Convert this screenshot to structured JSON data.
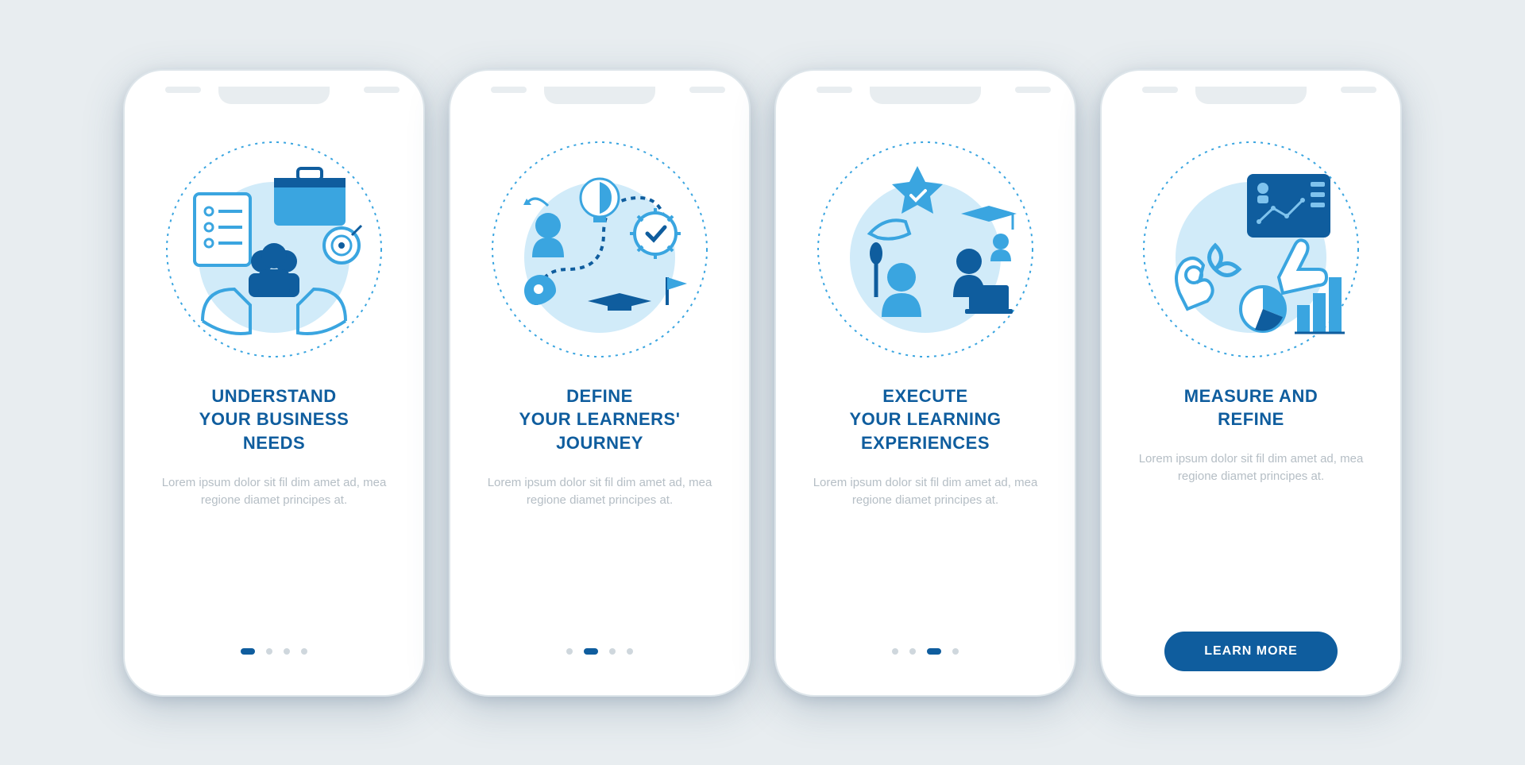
{
  "colors": {
    "primary": "#0f5d9e",
    "accent": "#3aa5e0",
    "light": "#d1ebf9",
    "muted": "#b5bec5"
  },
  "screens": [
    {
      "icon_name": "business-needs-icon",
      "title": "UNDERSTAND\nYOUR BUSINESS\nNEEDS",
      "body": "Lorem ipsum dolor sit fil dim amet ad, mea regione diamet principes at.",
      "active_dot": 0,
      "has_cta": false
    },
    {
      "icon_name": "learners-journey-icon",
      "title": "DEFINE\nYOUR LEARNERS'\nJOURNEY",
      "body": "Lorem ipsum dolor sit fil dim amet ad, mea regione diamet principes at.",
      "active_dot": 1,
      "has_cta": false
    },
    {
      "icon_name": "learning-experiences-icon",
      "title": "EXECUTE\nYOUR LEARNING\nEXPERIENCES",
      "body": "Lorem ipsum dolor sit fil dim amet ad, mea regione diamet principes at.",
      "active_dot": 2,
      "has_cta": false
    },
    {
      "icon_name": "measure-refine-icon",
      "title": "MEASURE AND\nREFINE",
      "body": "Lorem ipsum dolor sit fil dim amet ad, mea regione diamet principes at.",
      "active_dot": 3,
      "has_cta": true
    }
  ],
  "cta_label": "LEARN MORE",
  "dot_count": 4
}
